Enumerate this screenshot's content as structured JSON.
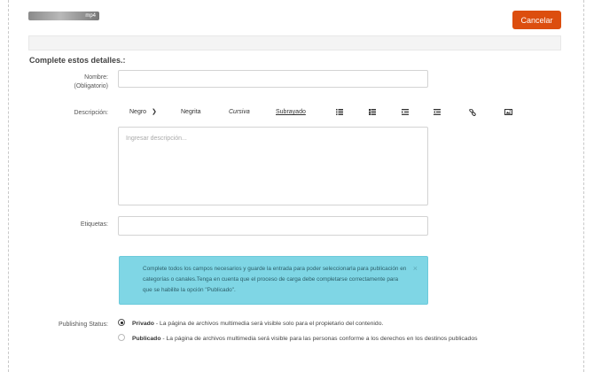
{
  "header": {
    "file_chip_text": "mp4",
    "cancel_label": "Cancelar"
  },
  "form": {
    "title": "Complete estos detalles.:",
    "name_label_line1": "Nombre:",
    "name_label_line2": "(Obligatorio)",
    "name_value": "",
    "description_label": "Descripción:",
    "description_placeholder": "Ingresar descripción...",
    "tags_label": "Etiquetas:",
    "tags_value": ""
  },
  "toolbar": {
    "font_select": "Negro",
    "bold": "Negrita",
    "italic": "Cursiva",
    "underline": "Subrayado",
    "icons": [
      "unordered-list-icon",
      "ordered-list-icon",
      "indent-icon",
      "outdent-icon",
      "link-icon",
      "image-icon"
    ]
  },
  "alert": {
    "message": "Complete todos los campos necesarios y guarde la entrada para poder seleccionarla para publicación en categorías o canales.Tenga en cuenta que el proceso de carga debe completarse correctamente para que se habilite la opción \"Publicado\".",
    "close": "×"
  },
  "publishing": {
    "label": "Publishing Status:",
    "options": [
      {
        "title": "Privado",
        "desc": " - La página de archivos multimedia será visible solo para el propietario del contenido.",
        "selected": true
      },
      {
        "title": "Publicado",
        "desc": " - La página de archivos multimedia será visible para las personas conforme a los derechos en los destinos publicados",
        "selected": false
      }
    ]
  },
  "colors": {
    "accent": "#dc4e0f",
    "alert_bg": "#7fd6e5"
  }
}
